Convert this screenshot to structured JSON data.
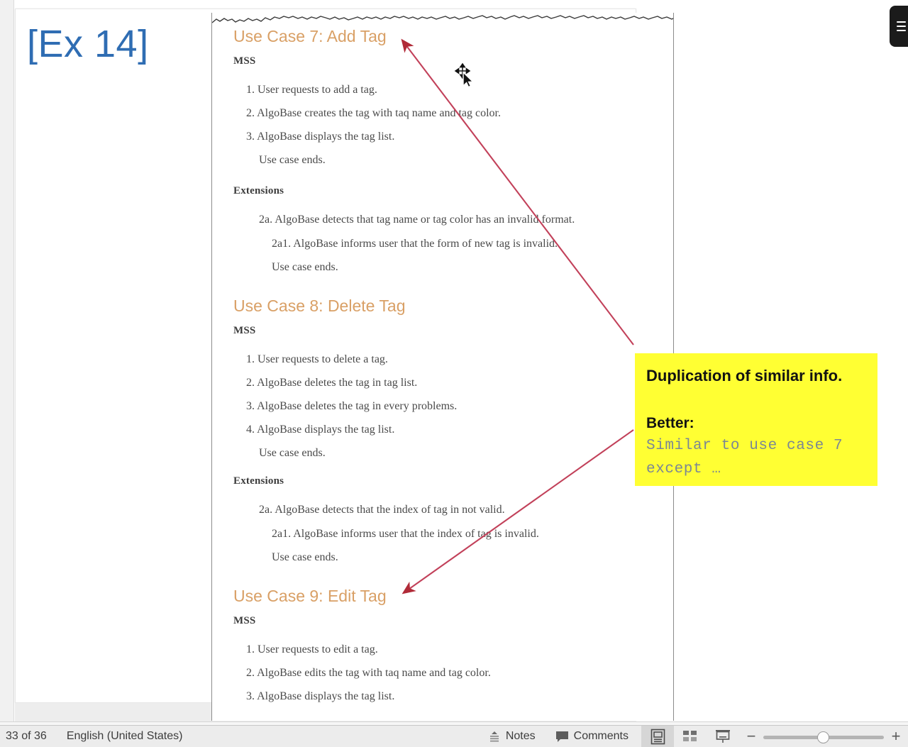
{
  "slide": {
    "title": "[Ex 14]",
    "title_color": "#2f6db3"
  },
  "document": {
    "use_cases": [
      {
        "heading": "Use Case 7: Add Tag",
        "mss_label": "MSS",
        "mss_steps": [
          "1. User requests to add a tag.",
          "2. AlgoBase creates the tag with taq name and tag color.",
          "3. AlgoBase displays the tag list."
        ],
        "mss_end": "Use case ends.",
        "extensions_label": "Extensions",
        "extension_steps": [
          "2a. AlgoBase detects that tag name or tag color has an invalid format.",
          "2a1. AlgoBase informs user that the form of new tag is invalid."
        ],
        "extensions_end": "Use case ends."
      },
      {
        "heading": "Use Case 8: Delete Tag",
        "mss_label": "MSS",
        "mss_steps": [
          "1. User requests to delete a tag.",
          "2. AlgoBase deletes the tag in tag list.",
          "3. AlgoBase deletes the tag in every problems.",
          "4. AlgoBase displays the tag list."
        ],
        "mss_end": "Use case ends.",
        "extensions_label": "Extensions",
        "extension_steps": [
          "2a. AlgoBase detects that the index of tag in not valid.",
          "2a1. AlgoBase informs user that the index of tag is invalid."
        ],
        "extensions_end": "Use case ends."
      },
      {
        "heading": "Use Case 9: Edit Tag",
        "mss_label": "MSS",
        "mss_steps": [
          "1. User requests to edit a tag.",
          "2. AlgoBase edits the tag with taq name and tag color.",
          "3. AlgoBase displays the tag list."
        ]
      }
    ]
  },
  "callout": {
    "line1": "Duplication of similar info.",
    "line2": "Better:",
    "code_line1": "Similar to use case 7",
    "code_line2": "except …",
    "background": "#ffff33",
    "code_color": "#7b8794"
  },
  "annotations": {
    "arrow_color": "#c2415a",
    "arrow1_label": "arrow-to-use-case-7",
    "arrow2_label": "arrow-to-use-case-9"
  },
  "statusbar": {
    "page_indicator": "33 of 36",
    "language": "English (United States)",
    "notes_label": "Notes",
    "comments_label": "Comments",
    "zoom_minus": "−",
    "zoom_plus": "+",
    "views": [
      {
        "name": "normal-view",
        "active": true
      },
      {
        "name": "slide-sorter-view",
        "active": false
      },
      {
        "name": "presentation-view",
        "active": false
      }
    ]
  }
}
